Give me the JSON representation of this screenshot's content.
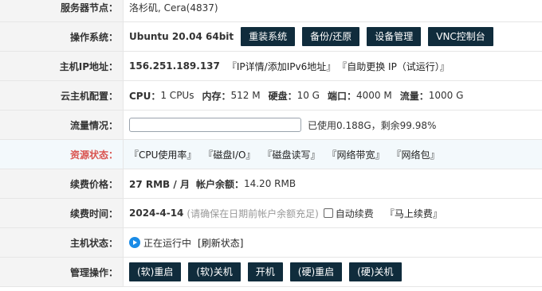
{
  "rows": {
    "node": {
      "label": "服务器节点：",
      "value": "洛杉矶, Cera(4837)"
    },
    "os": {
      "label": "操作系统：",
      "value": "Ubuntu 20.04 64bit",
      "buttons": [
        "重装系统",
        "备份/还原",
        "设备管理",
        "VNC控制台"
      ]
    },
    "ip": {
      "label": "主机IP地址：",
      "value": "156.251.189.137",
      "links": [
        "『IP详情/添加IPv6地址』",
        "『自助更换 IP（试运行）』"
      ]
    },
    "config": {
      "label": "云主机配置：",
      "cpu_label": "CPU：",
      "cpu_value": "1 CPUs",
      "mem_label": "内存：",
      "mem_value": "512 M",
      "disk_label": "硬盘：",
      "disk_value": "10 G",
      "port_label": "端口：",
      "port_value": "4000 M",
      "flow_label": "流量：",
      "flow_value": "1000 G"
    },
    "traffic": {
      "label": "流量情况：",
      "used_fraction": 0.0002,
      "text": "已使用0.188G，剩余99.98%"
    },
    "resource": {
      "label": "资源状态：",
      "links": [
        "『CPU使用率』",
        "『磁盘I/O』",
        "『磁盘读写』",
        "『网络带宽』",
        "『网络包』"
      ],
      "label_color": "#d9534f"
    },
    "price": {
      "label": "续费价格：",
      "price": "27 RMB / 月",
      "balance_label": "帐户余额：",
      "balance_value": "14.20 RMB"
    },
    "renew": {
      "label": "续费时间：",
      "date": "2024-4-14",
      "note": "(请确保在日期前帐户余额充足)",
      "auto_label": "自动续费",
      "renew_link": "『马上续费』"
    },
    "status": {
      "label": "主机状态：",
      "status_text": "正在运行中",
      "refresh": "[刷新状态]"
    },
    "manage": {
      "label": "管理操作：",
      "buttons": [
        "(软)重启",
        "(软)关机",
        "开机",
        "(硬)重启",
        "(硬)关机"
      ]
    }
  },
  "colors": {
    "button_bg": "#102c3c",
    "accent_red": "#d9534f",
    "status_blue": "#1a8be6"
  }
}
